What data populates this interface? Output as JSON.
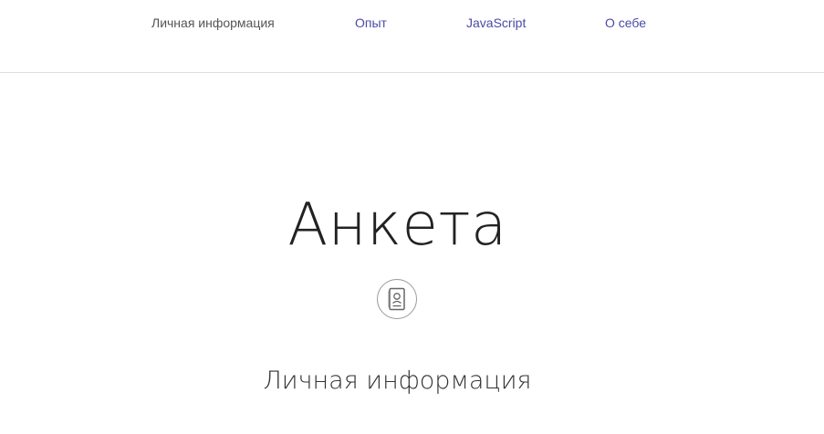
{
  "nav": {
    "items": [
      {
        "label": "Личная информация",
        "active": true
      },
      {
        "label": "Опыт",
        "active": false
      },
      {
        "label": "JavaScript",
        "active": false
      },
      {
        "label": "О себе",
        "active": false
      }
    ]
  },
  "page": {
    "title": "Анкета"
  },
  "section": {
    "icon": "passport-icon",
    "title": "Личная информация"
  },
  "colors": {
    "nav_active": "#555555",
    "nav_link": "#4a4aa6",
    "divider": "#dddddd",
    "icon_border": "#9a9a9a"
  }
}
